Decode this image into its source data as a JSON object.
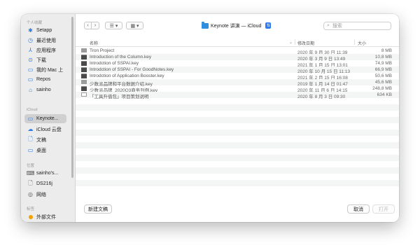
{
  "sidebar": {
    "favorites_header": "个人收藏",
    "favorites": [
      {
        "label": "Setapp",
        "icon": "setapp-icon"
      },
      {
        "label": "最近使用",
        "icon": "clock-icon"
      },
      {
        "label": "应用程序",
        "icon": "applications-icon"
      },
      {
        "label": "下载",
        "icon": "download-icon"
      },
      {
        "label": "我的 Mac 上",
        "icon": "folder-icon"
      },
      {
        "label": "Repos",
        "icon": "folder-icon"
      },
      {
        "label": "sainho",
        "icon": "home-icon"
      }
    ],
    "icloud_header": "iCloud",
    "icloud": [
      {
        "label": "Keynote...",
        "icon": "folder-icon",
        "selected": true
      },
      {
        "label": "iCloud 云盘",
        "icon": "cloud-icon"
      },
      {
        "label": "文稿",
        "icon": "document-icon"
      },
      {
        "label": "桌面",
        "icon": "desktop-icon"
      }
    ],
    "locations_header": "位置",
    "locations": [
      {
        "label": "sainho's...",
        "icon": "laptop-icon"
      },
      {
        "label": "DS216j",
        "icon": "drive-icon"
      },
      {
        "label": "网络",
        "icon": "network-icon"
      }
    ],
    "tags_header": "标签",
    "tags": [
      {
        "label": "外部文件",
        "color": "#f2a100"
      }
    ]
  },
  "toolbar": {
    "location_label": "Keynote 讲演 — iCloud",
    "search_placeholder": "搜索"
  },
  "columns": {
    "name": "名称",
    "date": "修改日期",
    "size": "大小"
  },
  "files": [
    {
      "name": "Tron Project",
      "date": "2020 年 9 月 30 日 11:39",
      "size": "8 MB",
      "type": "folder"
    },
    {
      "name": "Introduction of the Column.key",
      "date": "2020 年 3 月 9 日 13:49",
      "size": "10,8 MB",
      "type": "key"
    },
    {
      "name": "Introdction of SSPAI.key",
      "date": "2021 年 1 月 15 日 13:01",
      "size": "74,9 MB",
      "type": "key"
    },
    {
      "name": "Introdction of SSPAI - For GoodNotes.key",
      "date": "2020 年 10 月 15 日 11:13",
      "size": "66,9 MB",
      "type": "key"
    },
    {
      "name": "Introdction of Application Booster.key",
      "date": "2021 年 2 月 15 日 16:08",
      "size": "50,6 MB",
      "type": "key"
    },
    {
      "name": "少数派品牌和平台数据介绍.key",
      "date": "2019 年 1 月 14 日 01:47",
      "size": "45,6 MB",
      "type": "folder"
    },
    {
      "name": "少数派品牌_2020Q3商务刊例.key",
      "date": "2020 年 11 月 6 日 14:15",
      "size": "248,8 MB",
      "type": "key"
    },
    {
      "name": "「工具升值包」项目策划说明",
      "date": "2020 年 8 月 3 日 09:30",
      "size": "634 KB",
      "type": "doc"
    }
  ],
  "bottom": {
    "new_folder": "新建文稿",
    "cancel": "取消",
    "open": "打开"
  }
}
